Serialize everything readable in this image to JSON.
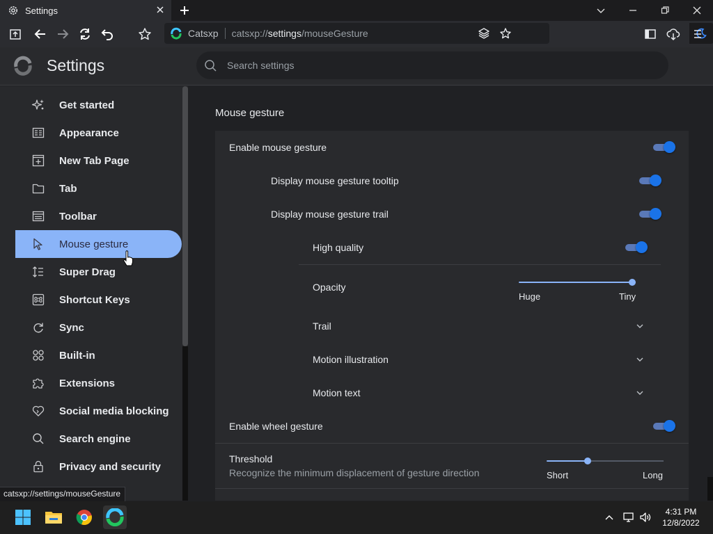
{
  "window": {
    "tab_title": "Settings"
  },
  "address_bar": {
    "site_name": "Catsxp",
    "url_prefix": "catsxp://",
    "url_host": "settings",
    "url_path": "/mouseGesture"
  },
  "header": {
    "title": "Settings",
    "search_placeholder": "Search settings"
  },
  "sidebar": {
    "items": [
      {
        "label": "Get started",
        "icon": "stars-icon"
      },
      {
        "label": "Appearance",
        "icon": "appearance-icon"
      },
      {
        "label": "New Tab Page",
        "icon": "new-tab-page-icon"
      },
      {
        "label": "Tab",
        "icon": "folder-tab-icon"
      },
      {
        "label": "Toolbar",
        "icon": "toolbar-icon"
      },
      {
        "label": "Mouse gesture",
        "icon": "cursor-arrow-icon",
        "active": true
      },
      {
        "label": "Super Drag",
        "icon": "super-drag-icon"
      },
      {
        "label": "Shortcut Keys",
        "icon": "command-key-icon"
      },
      {
        "label": "Sync",
        "icon": "sync-icon"
      },
      {
        "label": "Built-in",
        "icon": "grid-icon"
      },
      {
        "label": "Extensions",
        "icon": "puzzle-icon"
      },
      {
        "label": "Social media blocking",
        "icon": "heart-icon"
      },
      {
        "label": "Search engine",
        "icon": "search-icon"
      },
      {
        "label": "Privacy and security",
        "icon": "lock-icon"
      }
    ]
  },
  "main": {
    "section_title": "Mouse gesture",
    "enable_mouse_gesture": {
      "label": "Enable mouse gesture",
      "checked": true
    },
    "display_tooltip": {
      "label": "Display mouse gesture tooltip",
      "checked": true
    },
    "display_trail": {
      "label": "Display mouse gesture trail",
      "checked": true
    },
    "high_quality": {
      "label": "High quality",
      "checked": true
    },
    "opacity": {
      "label": "Opacity",
      "min_label": "Huge",
      "max_label": "Tiny",
      "value_fraction": 1.0
    },
    "trail": {
      "label": "Trail"
    },
    "motion_illustration": {
      "label": "Motion illustration"
    },
    "motion_text": {
      "label": "Motion text"
    },
    "enable_wheel_gesture": {
      "label": "Enable wheel gesture",
      "checked": true
    },
    "threshold": {
      "label": "Threshold",
      "description": "Recognize the minimum displacement of gesture direction",
      "min_label": "Short",
      "max_label": "Long",
      "value_fraction": 0.35
    }
  },
  "status_bar": {
    "url": "catsxp://settings/mouseGesture"
  },
  "taskbar": {
    "time": "4:31 PM",
    "date": "12/8/2022"
  },
  "colors": {
    "accent": "#8ab4f8",
    "toggle_knob": "#1a73e8",
    "background": "#202124",
    "card": "#292a2d"
  }
}
